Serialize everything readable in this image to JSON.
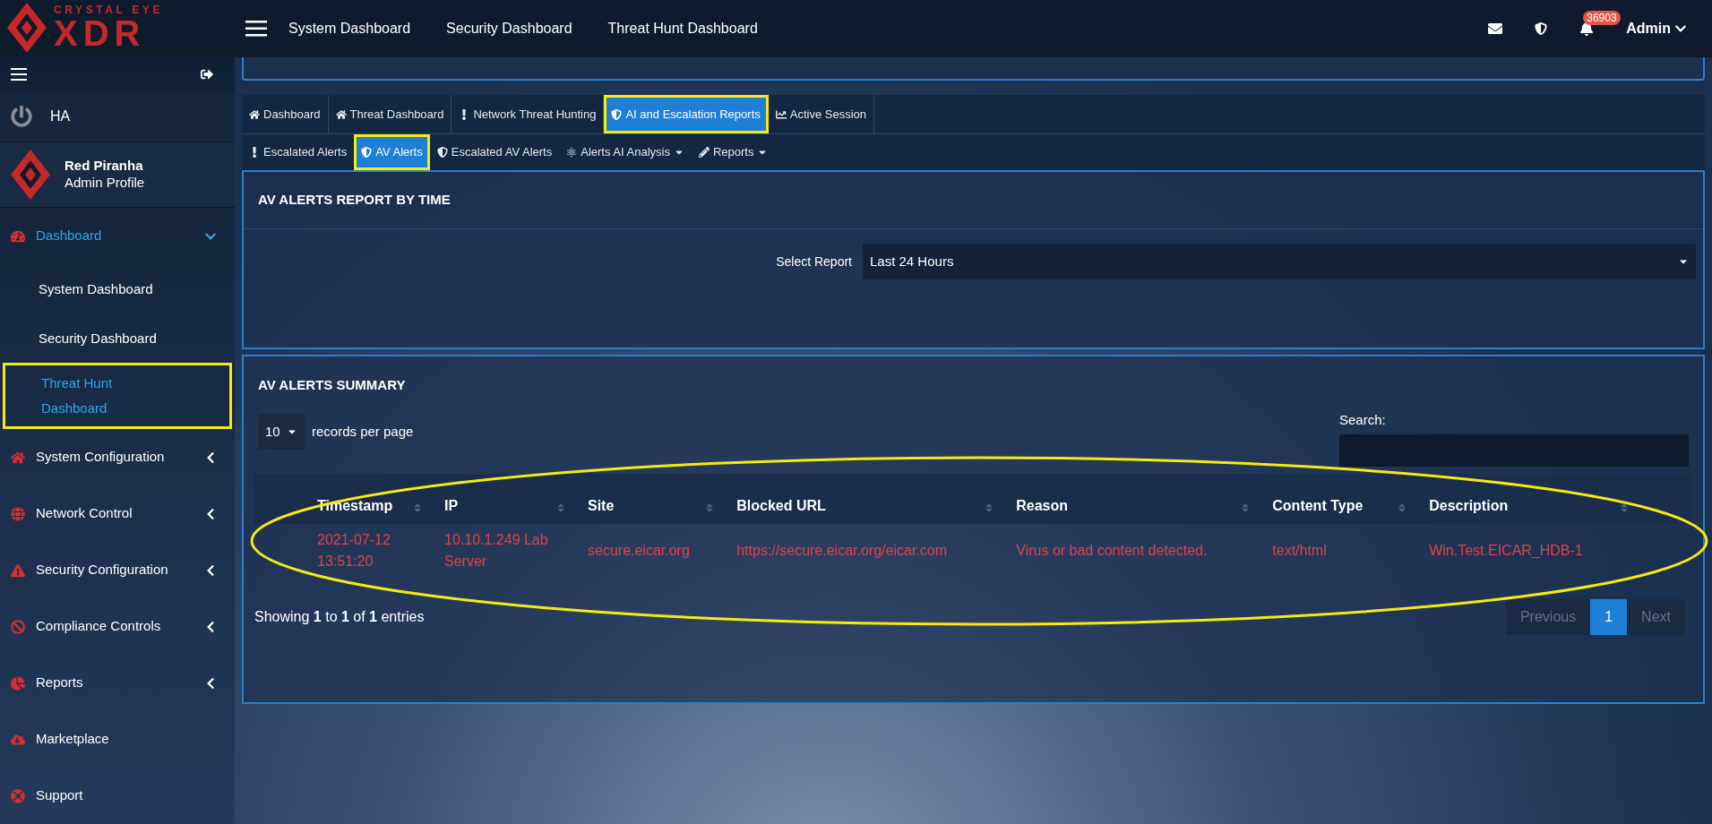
{
  "brand": {
    "top": "CRYSTAL EYE",
    "main": "XDR"
  },
  "header": {
    "links": [
      "System Dashboard",
      "Security Dashboard",
      "Threat Hunt Dashboard"
    ],
    "notification_count": "36903",
    "user": "Admin"
  },
  "sidebar": {
    "ha": "HA",
    "profile": {
      "name": "Red Piranha",
      "role": "Admin Profile"
    },
    "items": [
      {
        "label": "Dashboard",
        "expanded": true,
        "selected": true,
        "children": [
          {
            "label": "System Dashboard",
            "selected": false,
            "highlighted": false
          },
          {
            "label": "Security Dashboard",
            "selected": false,
            "highlighted": false
          },
          {
            "label": "Threat Hunt Dashboard",
            "selected": true,
            "highlighted": true
          }
        ]
      },
      {
        "label": "System Configuration",
        "expanded": false,
        "selected": false
      },
      {
        "label": "Network Control",
        "expanded": false,
        "selected": false
      },
      {
        "label": "Security Configuration",
        "expanded": false,
        "selected": false
      },
      {
        "label": "Compliance Controls",
        "expanded": false,
        "selected": false
      },
      {
        "label": "Reports",
        "expanded": false,
        "selected": false
      },
      {
        "label": "Marketplace",
        "selected": false
      },
      {
        "label": "Support",
        "selected": false
      }
    ]
  },
  "tabs": [
    {
      "label": "Dashboard",
      "selected": false,
      "highlighted": false
    },
    {
      "label": "Threat Dashboard",
      "selected": false,
      "highlighted": false
    },
    {
      "label": "Network Threat Hunting",
      "selected": false,
      "highlighted": false
    },
    {
      "label": "AI and Escalation Reports",
      "selected": true,
      "highlighted": true
    },
    {
      "label": "Active Session",
      "selected": false,
      "highlighted": false
    }
  ],
  "subtabs": [
    {
      "label": "Escalated Alerts",
      "selected": false,
      "highlighted": false,
      "dropdown": false
    },
    {
      "label": "AV Alerts",
      "selected": true,
      "highlighted": true,
      "dropdown": false
    },
    {
      "label": "Escalated AV Alerts",
      "selected": false,
      "highlighted": false,
      "dropdown": false
    },
    {
      "label": "Alerts AI Analysis",
      "selected": false,
      "highlighted": false,
      "dropdown": true
    },
    {
      "label": "Reports",
      "selected": false,
      "highlighted": false,
      "dropdown": true
    }
  ],
  "report_card": {
    "title": "AV ALERTS REPORT BY TIME",
    "select_label": "Select Report",
    "select_value": "Last 24 Hours"
  },
  "summary_card": {
    "title": "AV ALERTS SUMMARY",
    "page_size": "10",
    "page_size_suffix": "records per page",
    "search_label": "Search:",
    "table": {
      "circled": true,
      "columns": [
        "Timestamp",
        "IP",
        "Site",
        "Blocked URL",
        "Reason",
        "Content Type",
        "Description"
      ],
      "rows": [
        [
          "2021-07-12 13:51:20",
          "10.10.1.249 Lab Server",
          "secure.eicar.org",
          "https://secure.eicar.org/eicar.com",
          "Virus or bad content detected.",
          "text/html",
          "Win.Test.EICAR_HDB-1"
        ]
      ]
    },
    "info": "Showing **1** to **1** of **1** entries",
    "pagination": [
      {
        "label": "Previous",
        "selected": false
      },
      {
        "label": "1",
        "selected": true
      },
      {
        "label": "Next",
        "selected": false
      }
    ]
  }
}
